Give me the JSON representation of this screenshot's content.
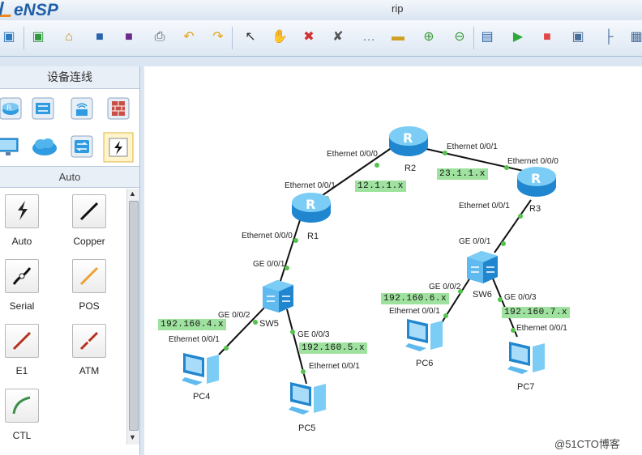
{
  "app": {
    "logo": "eNSP",
    "window_title": "rip"
  },
  "toolbar": {
    "buttons": [
      {
        "name": "new-topology",
        "icon": "new-file-icon",
        "glyph": "▣",
        "color": "#2d7bc2"
      },
      {
        "name": "new-page",
        "icon": "add-page-icon",
        "glyph": "▣",
        "color": "#2e9a3b"
      },
      {
        "name": "open",
        "icon": "open-folder-icon",
        "glyph": "⌂",
        "color": "#c88b16"
      },
      {
        "name": "save",
        "icon": "save-icon",
        "glyph": "■",
        "color": "#2a63ad"
      },
      {
        "name": "save-as",
        "icon": "save-as-icon",
        "glyph": "■",
        "color": "#6c2a8c"
      },
      {
        "name": "print",
        "icon": "print-icon",
        "glyph": "⎙",
        "color": "#555555"
      },
      {
        "name": "undo",
        "icon": "undo-icon",
        "glyph": "↶",
        "color": "#e2a21a"
      },
      {
        "name": "redo",
        "icon": "redo-icon",
        "glyph": "↷",
        "color": "#e2a21a"
      },
      {
        "name": "select",
        "icon": "pointer-icon",
        "glyph": "↖",
        "color": "#333333"
      },
      {
        "name": "pan",
        "icon": "hand-icon",
        "glyph": "✋",
        "color": "#d88a2a"
      },
      {
        "name": "delete",
        "icon": "delete-icon",
        "glyph": "✖",
        "color": "#d32f2f"
      },
      {
        "name": "delete-link",
        "icon": "delete-link-icon",
        "glyph": "✘",
        "color": "#555555"
      },
      {
        "name": "text",
        "icon": "comment-icon",
        "glyph": "…",
        "color": "#5a7fa8"
      },
      {
        "name": "shape",
        "icon": "rectangle-icon",
        "glyph": "▬",
        "color": "#d0a021"
      },
      {
        "name": "zoom-in",
        "icon": "zoom-in-icon",
        "glyph": "⊕",
        "color": "#3d9a3a"
      },
      {
        "name": "zoom-out",
        "icon": "zoom-out-icon",
        "glyph": "⊖",
        "color": "#3d9a3a"
      },
      {
        "name": "fit",
        "icon": "fit-screen-icon",
        "glyph": "▤",
        "color": "#2a63ad"
      },
      {
        "name": "start",
        "icon": "play-icon",
        "glyph": "▶",
        "color": "#2fa93a"
      },
      {
        "name": "stop",
        "icon": "stop-icon",
        "glyph": "■",
        "color": "#e04848"
      },
      {
        "name": "capture",
        "icon": "capture-icon",
        "glyph": "▣",
        "color": "#4a6e9a"
      },
      {
        "name": "topology",
        "icon": "tree-icon",
        "glyph": "├",
        "color": "#4a6e9a"
      },
      {
        "name": "grid",
        "icon": "grid-icon",
        "glyph": "▦",
        "color": "#4a6e9a"
      }
    ]
  },
  "left_panel": {
    "device_header": "设备连线",
    "cable_header": "Auto",
    "devices": [
      {
        "name": "router",
        "icon": "router-icon"
      },
      {
        "name": "switch",
        "icon": "switch-icon"
      },
      {
        "name": "wireless",
        "icon": "wireless-icon"
      },
      {
        "name": "firewall",
        "icon": "firewall-icon"
      },
      {
        "name": "terminal",
        "icon": "pc-monitor-icon"
      },
      {
        "name": "cloud",
        "icon": "cloud-icon"
      },
      {
        "name": "other",
        "icon": "other-device-icon"
      },
      {
        "name": "connection",
        "icon": "lightning-icon"
      }
    ],
    "cables": [
      {
        "label": "Auto",
        "icon": "auto-cable-icon",
        "color": "#222222"
      },
      {
        "label": "Copper",
        "icon": "copper-cable-icon",
        "color": "#111111"
      },
      {
        "label": "Serial",
        "icon": "serial-cable-icon",
        "color": "#111111"
      },
      {
        "label": "POS",
        "icon": "pos-cable-icon",
        "color": "#f0a030"
      },
      {
        "label": "E1",
        "icon": "e1-cable-icon",
        "color": "#b5301e"
      },
      {
        "label": "ATM",
        "icon": "atm-cable-icon",
        "color": "#b5301e"
      },
      {
        "label": "CTL",
        "icon": "ctl-cable-icon",
        "color": "#3b8f4a"
      }
    ]
  },
  "topology": {
    "devices": [
      {
        "id": "R2",
        "label": "R2",
        "type": "router"
      },
      {
        "id": "R1",
        "label": "R1",
        "type": "router"
      },
      {
        "id": "R3",
        "label": "R3",
        "type": "router"
      },
      {
        "id": "SW5",
        "label": "SW5",
        "type": "switch"
      },
      {
        "id": "SW6",
        "label": "SW6",
        "type": "switch"
      },
      {
        "id": "PC4",
        "label": "PC4",
        "type": "pc"
      },
      {
        "id": "PC5",
        "label": "PC5",
        "type": "pc"
      },
      {
        "id": "PC6",
        "label": "PC6",
        "type": "pc"
      },
      {
        "id": "PC7",
        "label": "PC7",
        "type": "pc"
      }
    ],
    "port_labels": [
      "Ethernet 0/0/0",
      "Ethernet 0/0/1",
      "Ethernet 0/0/0",
      "Ethernet 0/0/1",
      "Ethernet 0/0/0",
      "Ethernet 0/0/1",
      "GE 0/0/1",
      "GE 0/0/1",
      "GE 0/0/2",
      "Ethernet 0/0/1",
      "GE 0/0/3",
      "Ethernet 0/0/1",
      "GE 0/0/2",
      "Ethernet 0/0/1",
      "GE 0/0/3",
      "Ethernet 0/0/1"
    ],
    "networks": [
      "12.1.1.x",
      "23.1.1.x",
      "192.160.4.x",
      "192.160.5.x",
      "192.160.6.x",
      "192.160.7.x"
    ]
  },
  "watermark": "@51CTO博客",
  "colors": {
    "link_dot": "#55c24e",
    "subnet_bg": "#9fe29f",
    "device_blue": "#2f9be0"
  }
}
